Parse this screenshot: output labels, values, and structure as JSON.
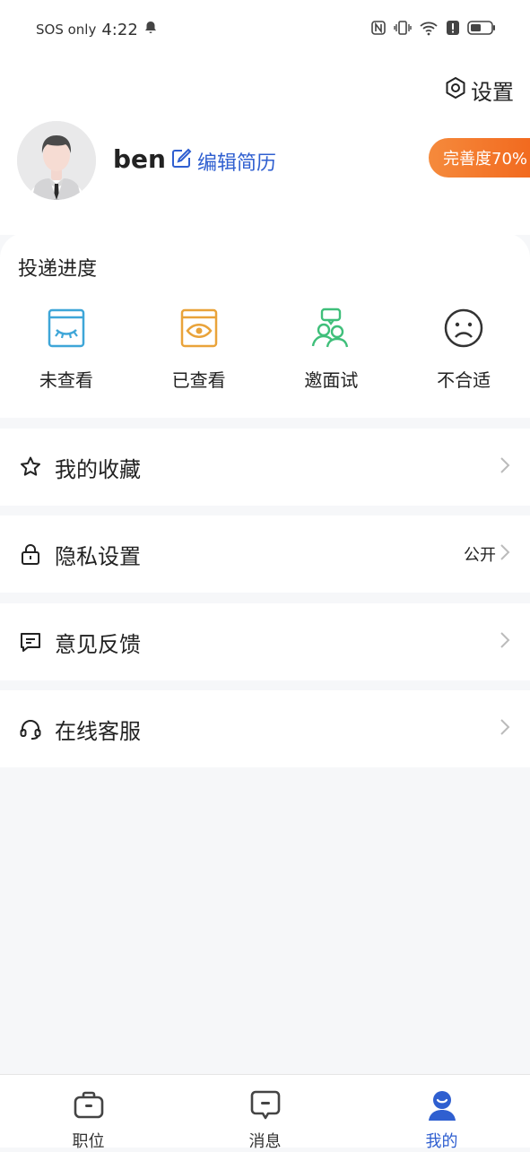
{
  "status_bar": {
    "carrier": "SOS only",
    "time": "4:22",
    "icons": [
      "bell-icon",
      "nfc-icon",
      "vibrate-icon",
      "wifi-icon",
      "alert-icon",
      "battery-icon"
    ]
  },
  "header": {
    "settings_label": "设置",
    "username": "ben",
    "edit_resume_label": "编辑简历",
    "completeness_label": "完善度70%"
  },
  "progress": {
    "title": "投递进度",
    "items": [
      {
        "label": "未查看",
        "icon": "eye-closed-icon",
        "color": "#3ea6d8"
      },
      {
        "label": "已查看",
        "icon": "eye-open-icon",
        "color": "#e9a33a"
      },
      {
        "label": "邀面试",
        "icon": "interview-icon",
        "color": "#3fbf7a"
      },
      {
        "label": "不合适",
        "icon": "sad-face-icon",
        "color": "#333333"
      }
    ]
  },
  "menu": {
    "favorites": {
      "label": "我的收藏",
      "icon": "star-icon"
    },
    "privacy": {
      "label": "隐私设置",
      "icon": "lock-icon",
      "value": "公开"
    },
    "feedback": {
      "label": "意见反馈",
      "icon": "message-icon"
    },
    "support": {
      "label": "在线客服",
      "icon": "headset-icon"
    }
  },
  "bottom_nav": {
    "items": [
      {
        "label": "职位",
        "icon": "briefcase-icon"
      },
      {
        "label": "消息",
        "icon": "chat-icon"
      },
      {
        "label": "我的",
        "icon": "profile-icon",
        "active": true
      }
    ]
  },
  "colors": {
    "accent": "#2f5fd0",
    "badge_gradient_start": "#f58a3c",
    "badge_gradient_end": "#f26a1f"
  }
}
